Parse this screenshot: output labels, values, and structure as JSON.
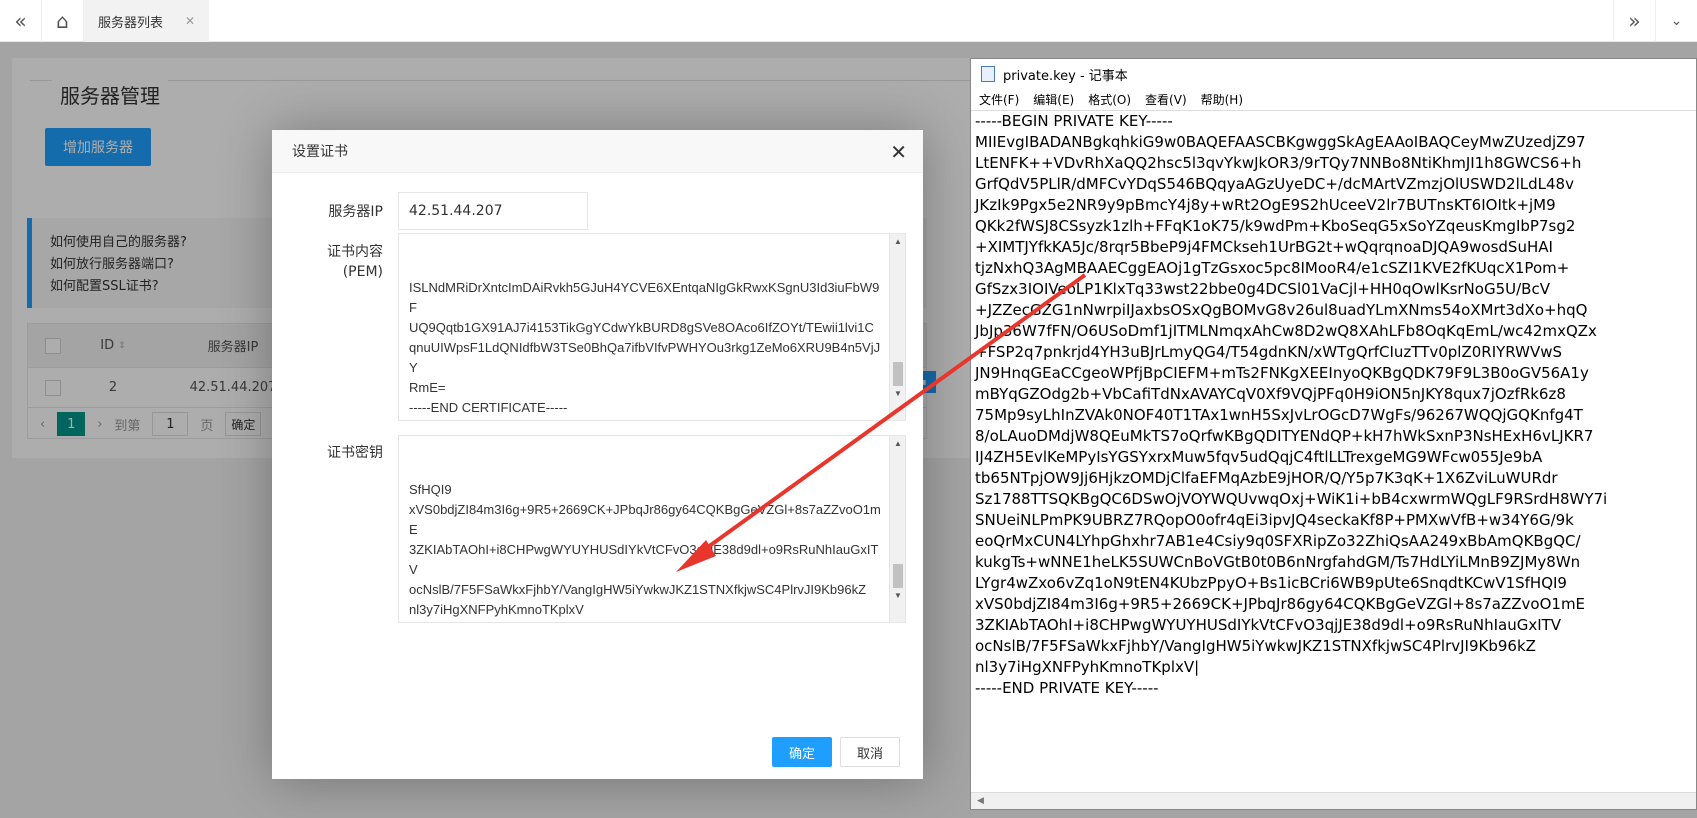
{
  "tabs": {
    "active_label": "服务器列表",
    "close_glyph": "✕"
  },
  "page": {
    "section_title": "服务器管理",
    "add_button": "增加服务器",
    "tips": [
      "如何使用自己的服务器?",
      "如何放行服务器端口?",
      "如何配置SSL证书?"
    ],
    "table": {
      "headers": [
        "ID",
        "服务器IP"
      ],
      "rows": [
        {
          "id": "2",
          "ip": "42.51.44.207"
        }
      ]
    },
    "pager": {
      "current": "1",
      "goto_label": "到第",
      "input": "1",
      "page_label": "页",
      "confirm": "确定"
    }
  },
  "modal": {
    "title": "设置证书",
    "ip_label": "服务器IP",
    "ip_value": "42.51.44.207",
    "cert_label": "证书内容",
    "cert_label_sub": "(PEM)",
    "cert_text": "ISLNdMRiDrXntcImDAiRvkh5GJuH4YCVE6XEntqaNIgGkRwxKSgnU3Id3iuFbW9F\nUQ9Qqtb1GX91AJ7i4153TikGgYCdwYkBURD8gSVe8OAco6IfZOYt/TEwii1lvi1C\nqnuUIWpsF1LdQNIdfbW3TSe0BhQa7ifbVIfvPWHYOu3rkg1ZeMo6XRU9B4n5VjJY\nRmE=\n-----END CERTIFICATE-----",
    "key_label": "证书密钥",
    "key_text": "SfHQI9\nxVS0bdjZI84m3I6g+9R5+2669CK+JPbqJr86gy64CQKBgGeVZGl+8s7aZZvoO1mE\n3ZKIAbTAOhI+i8CHPwgWYUYHUSdIYkVtCFvO3qjJE38d9dl+o9RsRuNhIauGxITV\nocNslB/7F5FSaWkxFjhbY/VangIgHW5iYwkwJKZ1STNXfkjwSC4PlrvJI9Kb96kZ\nnl3y7iHgXNFPyhKmnoTKplxV\n-----END PRIVATE KEY-----",
    "ok_button": "确定",
    "cancel_button": "取消"
  },
  "notepad": {
    "title": "private.key - 记事本",
    "menu": [
      "文件(F)",
      "编辑(E)",
      "格式(O)",
      "查看(V)",
      "帮助(H)"
    ],
    "text": "-----BEGIN PRIVATE KEY-----\nMIIEvgIBADANBgkqhkiG9w0BAQEFAASCBKgwggSkAgEAAoIBAQCeyMwZUzedjZ97\nLtENFK++VDvRhXaQQ2hsc5l3qvYkwJkOR3/9rTQy7NNBo8NtiKhmJI1h8GWCS6+h\nGrfQdV5PLlR/dMFCvYDqS546BQqyaAGzUyeDC+/dcMArtVZmzjOlUSWD2lLdL48v\nJKzIk9Pgx5e2NR9y9pBmcY4j8y+wRt2OgE9S2hUceeV2lr7BUTnsKT6IOItk+jM9\nQKk2fWSJ8CSsyzk1zlh+FFqK1oK75/k9wdPm+KboSeqG5xSoYZqeusKmgIbP7sg2\n+XIMTJYfkKA5Jc/8rqr5BbeP9j4FMCkseh1UrBG2t+wQqrqnoaDJQA9wosdSuHAI\ntjzNxhQ3AgMBAAECggEAOj1gTzGsxoc5pc8IMooR4/e1cSZI1KVE2fKUqcX1Pom+\nGfSzx3IOIVeoLP1KlxTq33wst22bbe0g4DCSl01VaCjl+HH0qOwlKsrNoG5U/BcV\n+JZZecGZG1nNwrpiIJaxbsOSxQgBOMvG8v26ul8uadYLmXNms54oXMrt3dXo+hqQ\nJbJp36W7fFN/O6USoDmf1jITMLNmqxAhCw8D2wQ8XAhLFb8OqKqEmL/wc42mxQZx\n+FSP2q7pnkrjd4YH3uBJrLmyQG4/T54gdnKN/xWTgQrfCIuzTTv0plZ0RIYRWVwS\nJN9HnqGEaCCgeoWPfjBpCIEFM+mTs2FNKgXEEInyoQKBgQDK79F9L3B0oGV56A1y\nmBYqGZOdg2b+VbCafiTdNxAVAYCqV0Xf9VQjPFq0H9iON5nJKY8qux7jOzfRk6z8\n75Mp9syLhInZVAk0NOF40T1TAx1wnH5SxJvLrOGcD7WgFs/96267WQQjGQKnfg4T\n8/oLAuoDMdjW8QEuMkTS7oQrfwKBgQDITYENdQP+kH7hWkSxnP3NsHExH6vLJKR7\nIJ4ZH5EvlKeMPyIsYGSYxrxMuw5fqv5udQqjC4ftlLLTrexgeMG9WFcw055Je9bA\ntb65NTpjOW9Jj6HjkzOMDjClfaEFMqAzbE9jHOR/Q/Y5p7K3qK+1X6ZviLuWURdr\nSz1788TTSQKBgQC6DSwOjVOYWQUvwqOxj+WiK1i+bB4cxwrmWQgLF9RSrdH8WY7i\nSNUeiNLPmPK9UBRZ7RQopO0ofr4qEi3ipvJQ4seckaKf8P+PMXwVfB+w34Y6G/9k\neoQrMxCUN4LYhpGhxhr7AB1e4Csiy9q0SFXRipZo32ZhiQsAA249xBbAmQKBgQC/\nkukgTs+wNNE1heLK5SUWCnBoVGtB0t0B6nNrgfahdGM/Ts7HdLYiLMnB9ZJMy8Wn\nLYgr4wZxo6vZq1oN9tEN4KUbzPpyO+Bs1icBCri6WB9pUte6SnqdtKCwV1SfHQI9\nxVS0bdjZI84m3I6g+9R5+2669CK+JPbqJr86gy64CQKBgGeVZGl+8s7aZZvoO1mE\n3ZKIAbTAOhI+i8CHPwgWYUYHUSdIYkVtCFvO3qjJE38d9dl+o9RsRuNhIauGxITV\nocNslB/7F5FSaWkxFjhbY/VangIgHW5iYwkwJKZ1STNXfkjwSC4PlrvJI9Kb96kZ\nnl3y7iHgXNFPyhKmnoTKplxV|\n-----END PRIVATE KEY-----"
  },
  "colors": {
    "primary": "#1E9FFF",
    "pager_active": "#009688",
    "arrow": "#E8362D"
  }
}
